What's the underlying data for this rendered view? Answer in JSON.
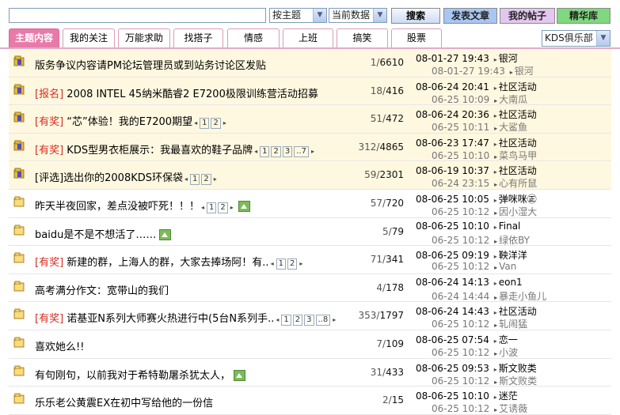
{
  "search": {
    "placeholder": "",
    "value": ""
  },
  "selects": {
    "by_topic": "按主题",
    "current_data": "当前数据",
    "club": "KDS俱乐部"
  },
  "buttons": {
    "search": "搜索",
    "post": "发表文章",
    "my_posts": "我的帖子",
    "essence": "精华库"
  },
  "colors": {
    "post_btn": "#a8c6f2",
    "my_posts_btn": "#e3c7f0",
    "essence_btn": "#7fd87f",
    "active_tab": "#e87aa9"
  },
  "tabs": [
    "主题内容",
    "我的关注",
    "万能求助",
    "找搭子",
    "情感",
    "上班",
    "搞笑",
    "股票"
  ],
  "rows": [
    {
      "sticky": true,
      "icon": "hot-folder-icon",
      "tag": "",
      "title": "版务争议内容请PM论坛管理员或到站务讨论区发贴",
      "pages": [],
      "image": false,
      "replies": "1",
      "views": "6610",
      "post_time": "08-01-27 19:43",
      "author": "银河",
      "last_time": "08-01-27 19:43",
      "last_user": "银河"
    },
    {
      "sticky": true,
      "icon": "hot-folder-icon",
      "tag": "[报名]",
      "title": "2008 INTEL 45纳米酷睿2 E7200极限训练营活动招募",
      "pages": [],
      "image": false,
      "replies": "18",
      "views": "416",
      "post_time": "08-06-24 20:41",
      "author": "社区活动",
      "last_time": "06-25 10:09",
      "last_user": "大南瓜"
    },
    {
      "sticky": true,
      "icon": "hot-folder-icon",
      "tag": "[有奖]",
      "title": "“芯”体验！我的E7200期望",
      "pages": [
        "1",
        "2"
      ],
      "image": false,
      "replies": "51",
      "views": "472",
      "post_time": "08-06-24 20:36",
      "author": "社区活动",
      "last_time": "06-25 10:11",
      "last_user": "大鲨鱼"
    },
    {
      "sticky": true,
      "icon": "hot-folder-icon",
      "tag": "[有奖]",
      "title": "KDS型男衣柜展示：我最喜欢的鞋子品牌",
      "pages": [
        "1",
        "2",
        "3",
        "..7"
      ],
      "image": false,
      "replies": "312",
      "views": "4865",
      "post_time": "08-06-23 17:47",
      "author": "社区活动",
      "last_time": "06-25 10:10",
      "last_user": "菜鸟马甲"
    },
    {
      "sticky": true,
      "icon": "hot-folder-icon",
      "tag": "",
      "title": "[评选]选出你的2008KDS环保袋",
      "pages": [
        "1",
        "2"
      ],
      "image": false,
      "replies": "59",
      "views": "2301",
      "post_time": "08-06-19 10:37",
      "author": "社区活动",
      "last_time": "06-24 23:15",
      "last_user": "心有所鼠"
    },
    {
      "sticky": false,
      "icon": "folder-icon",
      "tag": "",
      "title": "昨天半夜回家，差点没被吓死！！！",
      "pages": [
        "1",
        "2"
      ],
      "image": true,
      "replies": "57",
      "views": "720",
      "post_time": "08-06-25 10:05",
      "author": "弹咪咪㊣",
      "last_time": "06-25 10:12",
      "last_user": "因小湿大"
    },
    {
      "sticky": false,
      "icon": "folder-icon",
      "tag": "",
      "title": "baidu是不是不想活了……",
      "pages": [],
      "image": true,
      "replies": "5",
      "views": "79",
      "post_time": "08-06-25 10:10",
      "author": "Final",
      "last_time": "06-25 10:12",
      "last_user": "绿依BY"
    },
    {
      "sticky": false,
      "icon": "folder-icon",
      "tag": "[有奖]",
      "title": "新建的群，上海人的群，大家去捧场阿！有..",
      "pages": [
        "1",
        "2"
      ],
      "image": false,
      "replies": "71",
      "views": "341",
      "post_time": "08-06-25 09:19",
      "author": "鞅洋洋",
      "last_time": "06-25 10:12",
      "last_user": "Van"
    },
    {
      "sticky": false,
      "icon": "folder-icon",
      "tag": "",
      "title": "高考满分作文：宽带山的我们",
      "pages": [],
      "image": false,
      "replies": "4",
      "views": "178",
      "post_time": "08-06-24 14:13",
      "author": "eon1",
      "last_time": "06-24 14:44",
      "last_user": "暴走小鱼儿"
    },
    {
      "sticky": false,
      "icon": "folder-icon",
      "tag": "[有奖]",
      "title": "诺基亚N系列大师赛火热进行中(5台N系列手..",
      "pages": [
        "1",
        "2",
        "3",
        "..8"
      ],
      "image": false,
      "replies": "353",
      "views": "1797",
      "post_time": "08-06-24 14:43",
      "author": "社区活动",
      "last_time": "06-25 10:12",
      "last_user": "轧闹猛"
    },
    {
      "sticky": false,
      "icon": "folder-icon",
      "tag": "",
      "title": "喜欢她么!!",
      "pages": [],
      "image": false,
      "replies": "7",
      "views": "109",
      "post_time": "08-06-25 07:54",
      "author": "恋一",
      "last_time": "06-25 10:12",
      "last_user": "小波"
    },
    {
      "sticky": false,
      "icon": "folder-icon",
      "tag": "",
      "title": "有句刚句，以前我对于希特勒屠杀犹太人，",
      "pages": [],
      "image": true,
      "replies": "31",
      "views": "433",
      "post_time": "08-06-25 09:53",
      "author": "斯文败类",
      "last_time": "06-25 10:12",
      "last_user": "斯文败类"
    },
    {
      "sticky": false,
      "icon": "folder-icon",
      "tag": "",
      "title": "乐乐老公黄震EX在初中写给他的一份信",
      "pages": [],
      "image": false,
      "replies": "2",
      "views": "15",
      "post_time": "08-06-25 10:10",
      "author": "迷茫",
      "last_time": "06-25 10:12",
      "last_user": "艾诱薇"
    }
  ]
}
